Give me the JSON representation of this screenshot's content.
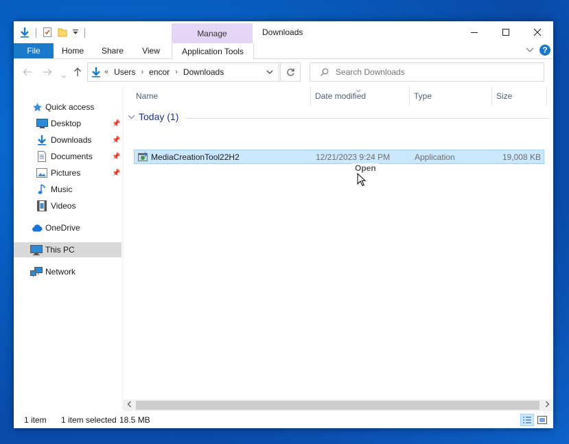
{
  "window": {
    "title": "Downloads",
    "contextual_group": "Manage"
  },
  "ribbon": {
    "tabs": [
      {
        "label": "File"
      },
      {
        "label": "Home"
      },
      {
        "label": "Share"
      },
      {
        "label": "View"
      },
      {
        "label": "Application Tools"
      }
    ]
  },
  "address": {
    "overflow": "«",
    "crumbs": [
      "Users",
      "encor",
      "Downloads"
    ]
  },
  "search": {
    "placeholder": "Search Downloads"
  },
  "sidebar": {
    "items": [
      {
        "label": "Quick access",
        "icon": "star-icon"
      },
      {
        "label": "Desktop",
        "icon": "desktop-icon",
        "pinned": true
      },
      {
        "label": "Downloads",
        "icon": "download-arrow-icon",
        "pinned": true
      },
      {
        "label": "Documents",
        "icon": "documents-icon",
        "pinned": true
      },
      {
        "label": "Pictures",
        "icon": "pictures-icon",
        "pinned": true
      },
      {
        "label": "Music",
        "icon": "music-icon"
      },
      {
        "label": "Videos",
        "icon": "videos-icon"
      },
      {
        "label": "OneDrive",
        "icon": "cloud-icon"
      },
      {
        "label": "This PC",
        "icon": "computer-icon",
        "selected": true
      },
      {
        "label": "Network",
        "icon": "network-icon"
      }
    ]
  },
  "columns": [
    "Name",
    "Date modified",
    "Type",
    "Size"
  ],
  "group": {
    "label": "Today (1)"
  },
  "files": [
    {
      "name": "MediaCreationTool22H2",
      "date_modified": "12/21/2023 9:24 PM",
      "type": "Application",
      "size": "19,008 KB",
      "selected": true
    }
  ],
  "drag_tooltip": "Open",
  "status": {
    "item_count": "1 item",
    "selection": "1 item selected",
    "selection_size": "18.5 MB"
  },
  "colors": {
    "accent": "#1979ca",
    "selection_bg": "#cce8ff",
    "manage_tab_bg": "#e6d6f5",
    "desktop_bg": "#0757b8"
  }
}
